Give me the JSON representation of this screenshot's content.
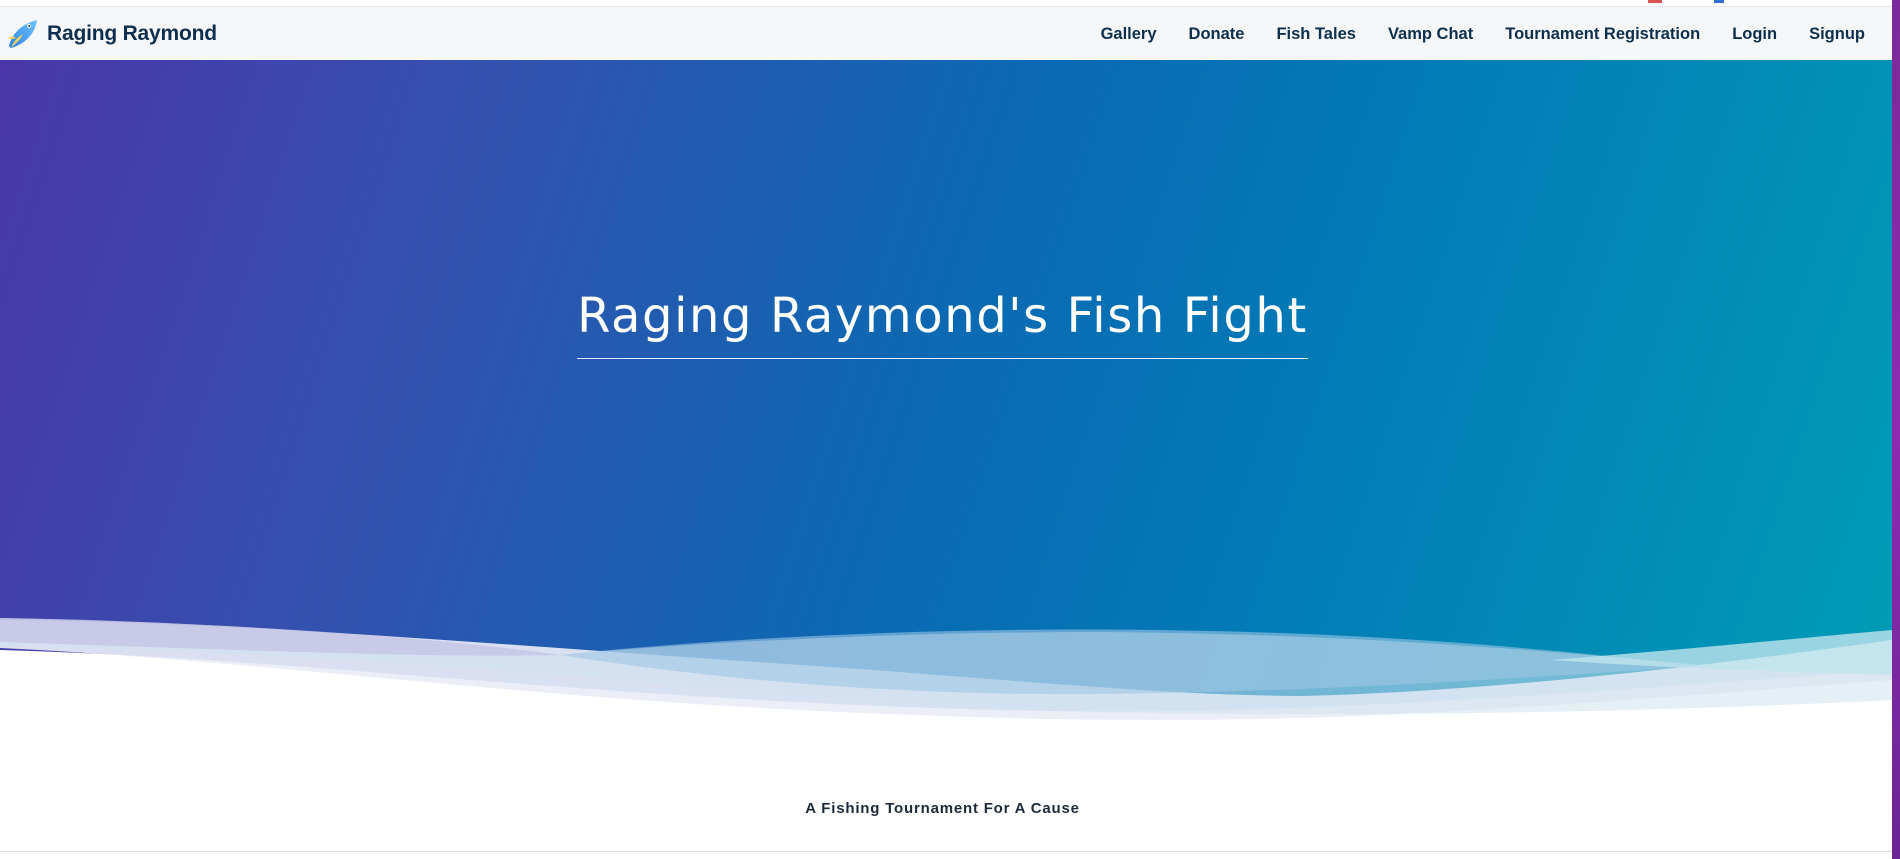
{
  "navbar": {
    "brand_name": "Raging Raymond",
    "brand_logo_icon": "fish-logo-icon",
    "links": [
      {
        "label": "Gallery"
      },
      {
        "label": "Donate"
      },
      {
        "label": "Fish Tales"
      },
      {
        "label": "Vamp Chat"
      },
      {
        "label": "Tournament Registration"
      },
      {
        "label": "Login"
      },
      {
        "label": "Signup"
      }
    ]
  },
  "hero": {
    "title": "Raging Raymond's Fish Fight",
    "gradient_colors": [
      "#4a36a8",
      "#0a6ab3",
      "#009db7"
    ]
  },
  "tagline": "A Fishing Tournament For A Cause",
  "colors": {
    "nav_text": "#0d2f4f",
    "nav_background": "#f6f7f9",
    "edge_accent": "#8e2bb0"
  }
}
